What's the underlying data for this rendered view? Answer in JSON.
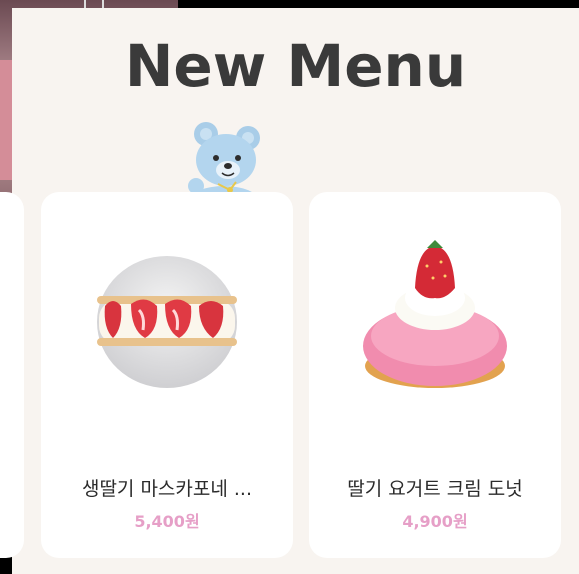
{
  "header": {
    "title": "New Menu"
  },
  "products": [
    {
      "name": "생딸기 마스카포네 ...",
      "price": "5,400원",
      "image": "strawberry-mascarpone-donut"
    },
    {
      "name": "딸기 요거트 크림 도넛",
      "price": "4,900원",
      "image": "strawberry-yogurt-cream-donut"
    }
  ],
  "colors": {
    "background": "#f8f4f0",
    "card": "#ffffff",
    "price": "#e69fc7",
    "title": "#3a3a3a"
  }
}
